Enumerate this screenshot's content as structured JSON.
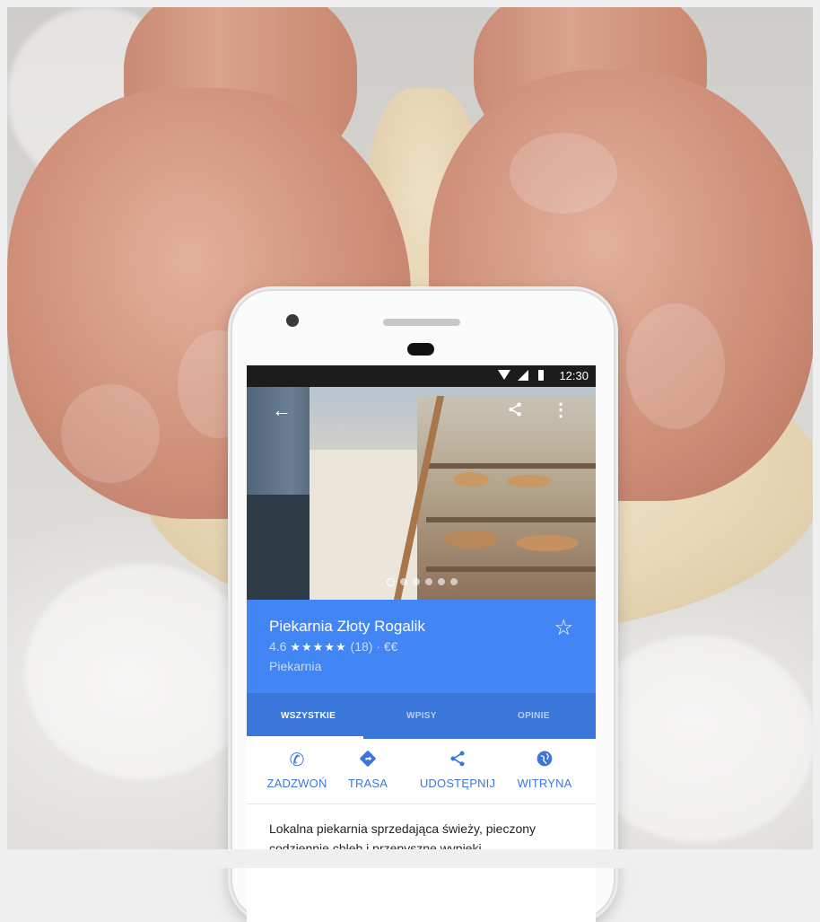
{
  "status_bar": {
    "time": "12:30"
  },
  "hero": {
    "back_icon": "arrow-left-icon",
    "share_icon": "share-icon",
    "menu_icon": "more-vert-icon"
  },
  "place": {
    "name": "Piekarnia Złoty Rogalik",
    "rating": "4.6",
    "stars_text": "★★★★★",
    "reviews_price": "(18) · €€",
    "category": "Piekarnia"
  },
  "tabs": [
    {
      "label": "WSZYSTKIE",
      "active": true
    },
    {
      "label": "WPISY",
      "active": false
    },
    {
      "label": "OPINIE",
      "active": false
    }
  ],
  "actions": [
    {
      "label": "ZADZWOŃ",
      "icon": "phone-icon"
    },
    {
      "label": "TRASA",
      "icon": "directions-icon"
    },
    {
      "label": "UDOSTĘPNIJ",
      "icon": "share-icon"
    },
    {
      "label": "WITRYNA",
      "icon": "globe-icon"
    }
  ],
  "description": "Lokalna piekarnia sprzedająca świeży, pieczony codziennie chleb i przepyszne wypieki.",
  "colors": {
    "brand_blue": "#4285f4",
    "tab_blue": "#3b77db"
  }
}
